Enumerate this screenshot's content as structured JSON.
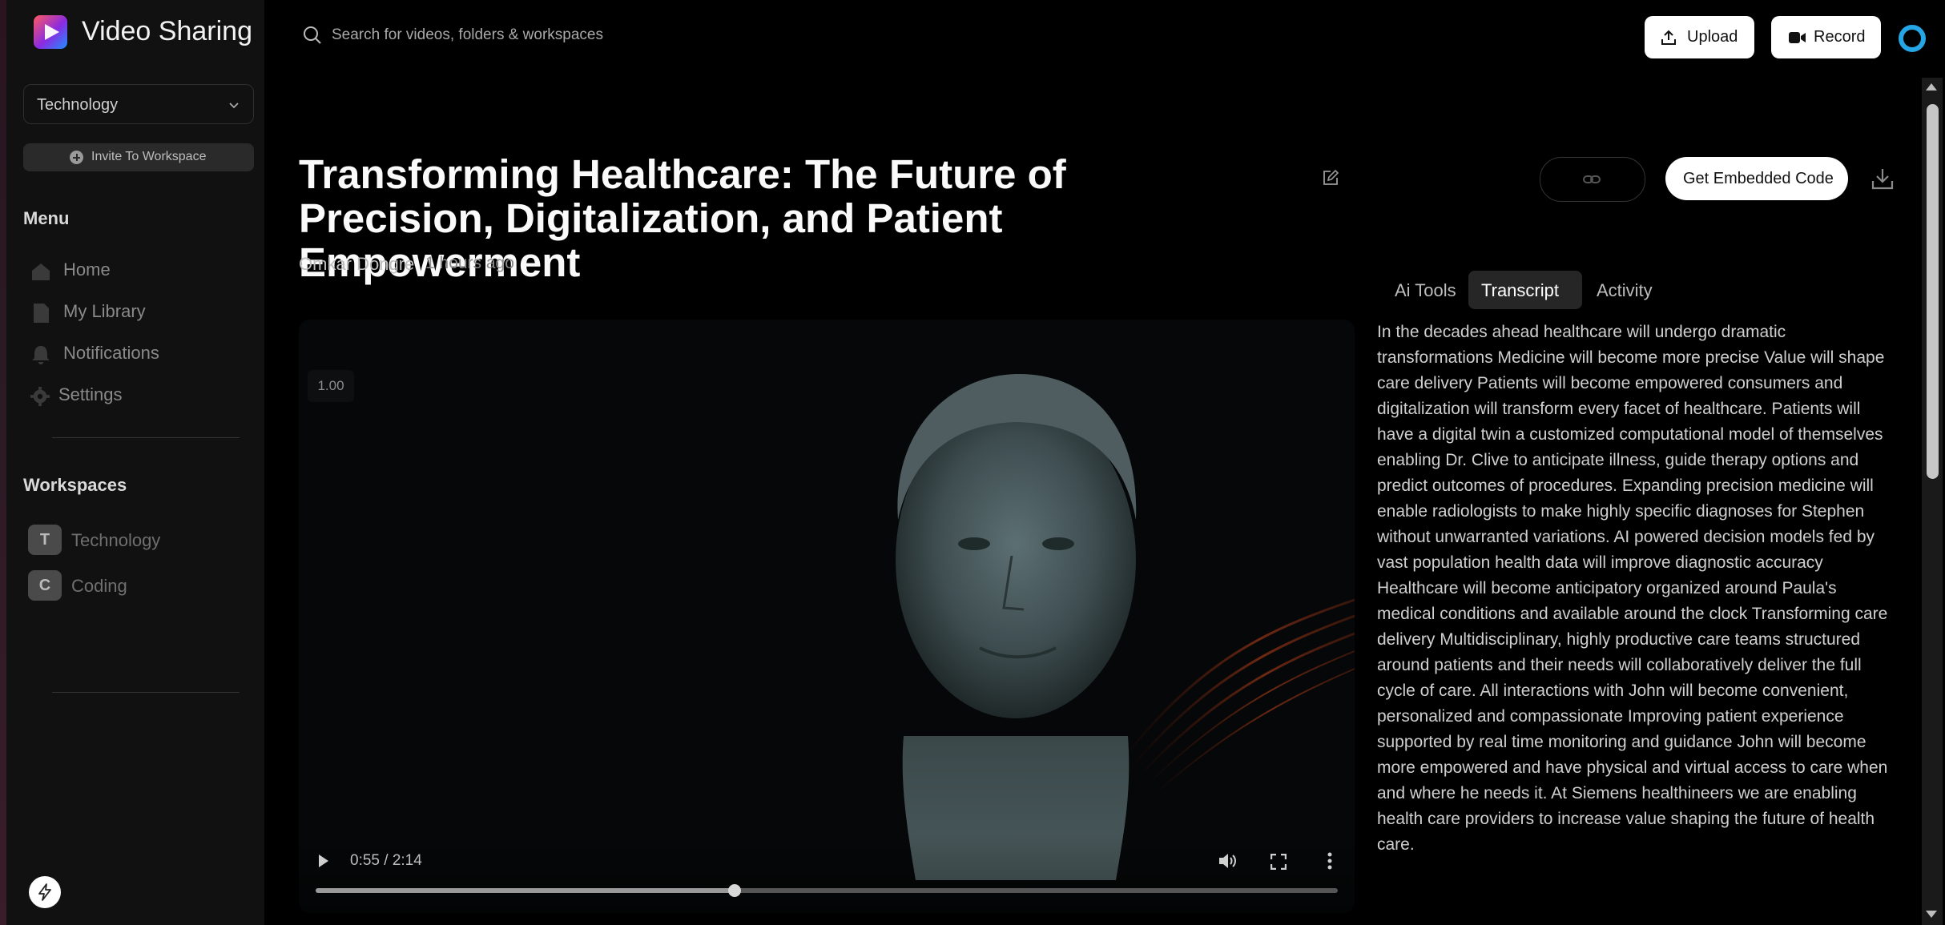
{
  "app": {
    "name": "Video Sharing"
  },
  "sidebar": {
    "workspace_select": "Technology",
    "invite_label": "Invite To Workspace",
    "menu_title": "Menu",
    "menu": [
      {
        "label": "Home",
        "icon": "home-icon"
      },
      {
        "label": "My Library",
        "icon": "library-icon"
      },
      {
        "label": "Notifications",
        "icon": "bell-icon"
      },
      {
        "label": "Settings",
        "icon": "gear-icon"
      }
    ],
    "workspaces_title": "Workspaces",
    "workspaces": [
      {
        "initial": "T",
        "name": "Technology"
      },
      {
        "initial": "C",
        "name": "Coding"
      }
    ]
  },
  "search": {
    "placeholder": "Search for videos, folders & workspaces"
  },
  "header": {
    "upload_label": "Upload",
    "record_label": "Record"
  },
  "video": {
    "title": "Transforming Healthcare: The Future of Precision, Digitalization, and Patient Empowerment",
    "author": "Omkar Dongre",
    "time_ago": "1 hours ago",
    "speed": "1.00",
    "time_display": "0:55 / 2:14",
    "progress": 0.41
  },
  "actions": {
    "embed_label": "Get Embedded Code"
  },
  "tabs": [
    {
      "label": "Ai Tools",
      "active": false
    },
    {
      "label": "Transcript",
      "active": true
    },
    {
      "label": "Activity",
      "active": false
    }
  ],
  "transcript": "In the decades ahead healthcare will undergo dramatic transformations Medicine will become more precise Value will shape care delivery Patients will become empowered consumers and digitalization will transform every facet of healthcare. Patients will have a digital twin a customized computational model of themselves enabling Dr. Clive to anticipate illness, guide therapy options and predict outcomes of procedures. Expanding precision medicine will enable radiologists to make highly specific diagnoses for Stephen without unwarranted variations. AI powered decision models fed by vast population health data will improve diagnostic accuracy Healthcare will become anticipatory organized around Paula's medical conditions and available around the clock Transforming care delivery Multidisciplinary, highly productive care teams structured around patients and their needs will collaboratively deliver the full cycle of care. All interactions with John will become convenient, personalized and compassionate Improving patient experience supported by real time monitoring and guidance John will become more empowered and have physical and virtual access to care when and where he needs it. At Siemens healthineers we are enabling health care providers to increase value shaping the future of health care.",
  "colors": {
    "background": "#000000",
    "sidebar": "#111111",
    "accent": "#27a6e6"
  }
}
